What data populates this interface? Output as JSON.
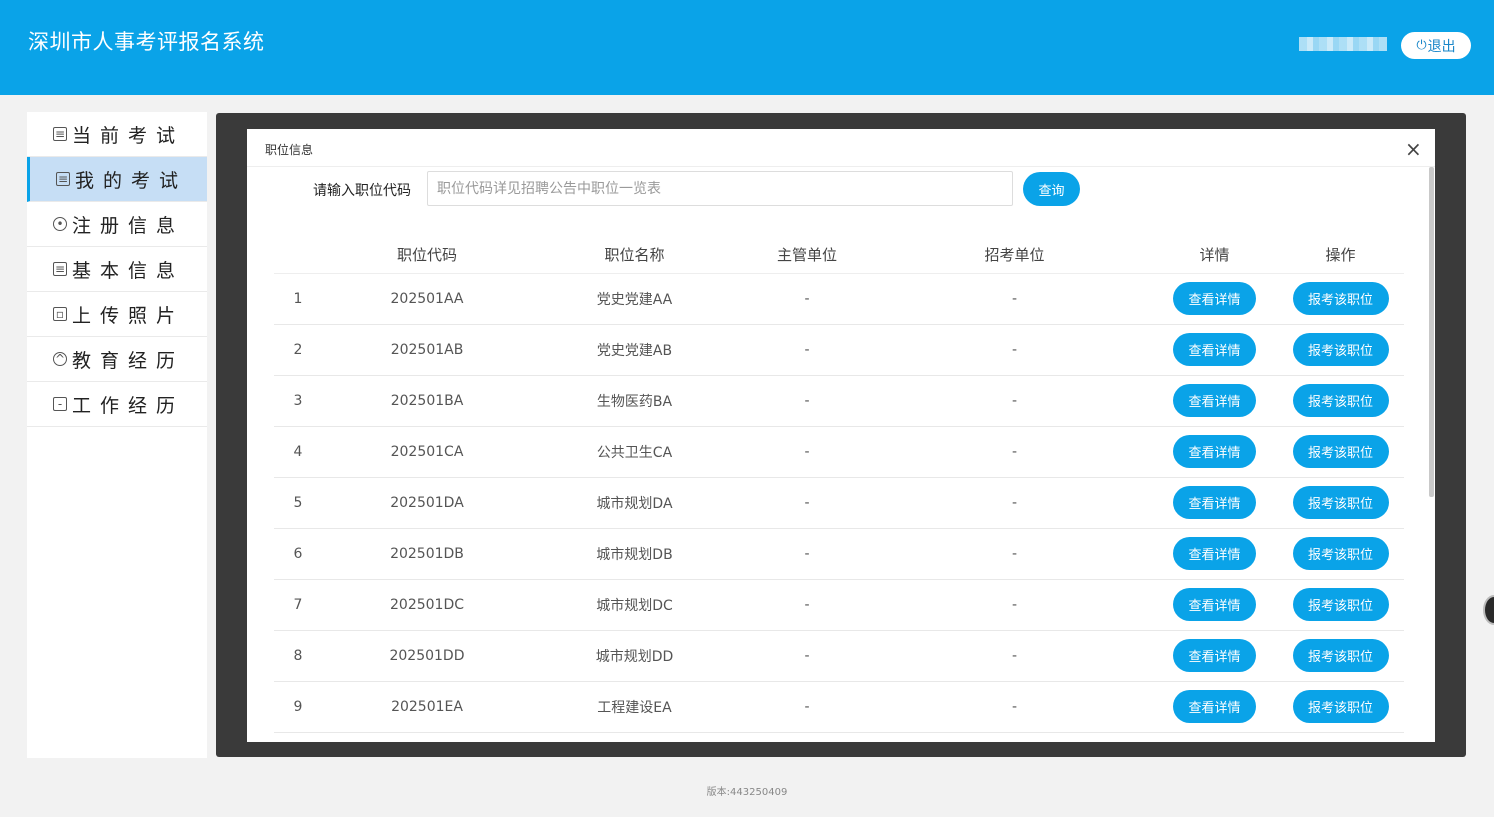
{
  "header": {
    "title": "深圳市人事考评报名系统",
    "logout_label": "退出",
    "logout_icon": "power-icon"
  },
  "sidebar": {
    "items": [
      {
        "label": "当前考试",
        "icon": "exam-icon",
        "active": false
      },
      {
        "label": "我的考试",
        "icon": "my-exam-icon",
        "active": true
      },
      {
        "label": "注册信息",
        "icon": "user-icon",
        "active": false
      },
      {
        "label": "基本信息",
        "icon": "profile-icon",
        "active": false
      },
      {
        "label": "上传照片",
        "icon": "photo-icon",
        "active": false
      },
      {
        "label": "教育经历",
        "icon": "graduation-icon",
        "active": false
      },
      {
        "label": "工作经历",
        "icon": "briefcase-icon",
        "active": false
      }
    ]
  },
  "modal": {
    "title": "职位信息",
    "close_symbol": "×",
    "search_label": "请输入职位代码",
    "search_placeholder": "职位代码详见招聘公告中职位一览表",
    "query_label": "查询",
    "columns": [
      "",
      "职位代码",
      "职位名称",
      "主管单位",
      "招考单位",
      "详情",
      "操作"
    ],
    "detail_label": "查看详情",
    "apply_label": "报考该职位",
    "rows": [
      {
        "no": "1",
        "code": "202501AA",
        "name": "党史党建AA",
        "dept": "-",
        "unit": "-"
      },
      {
        "no": "2",
        "code": "202501AB",
        "name": "党史党建AB",
        "dept": "-",
        "unit": "-"
      },
      {
        "no": "3",
        "code": "202501BA",
        "name": "生物医药BA",
        "dept": "-",
        "unit": "-"
      },
      {
        "no": "4",
        "code": "202501CA",
        "name": "公共卫生CA",
        "dept": "-",
        "unit": "-"
      },
      {
        "no": "5",
        "code": "202501DA",
        "name": "城市规划DA",
        "dept": "-",
        "unit": "-"
      },
      {
        "no": "6",
        "code": "202501DB",
        "name": "城市规划DB",
        "dept": "-",
        "unit": "-"
      },
      {
        "no": "7",
        "code": "202501DC",
        "name": "城市规划DC",
        "dept": "-",
        "unit": "-"
      },
      {
        "no": "8",
        "code": "202501DD",
        "name": "城市规划DD",
        "dept": "-",
        "unit": "-"
      },
      {
        "no": "9",
        "code": "202501EA",
        "name": "工程建设EA",
        "dept": "-",
        "unit": "-"
      }
    ]
  },
  "footer": {
    "version": "版本:443250409"
  },
  "colors": {
    "primary": "#0aa3e8",
    "sidebar_active": "#c6def5",
    "overlay": "#3a3a3a"
  }
}
